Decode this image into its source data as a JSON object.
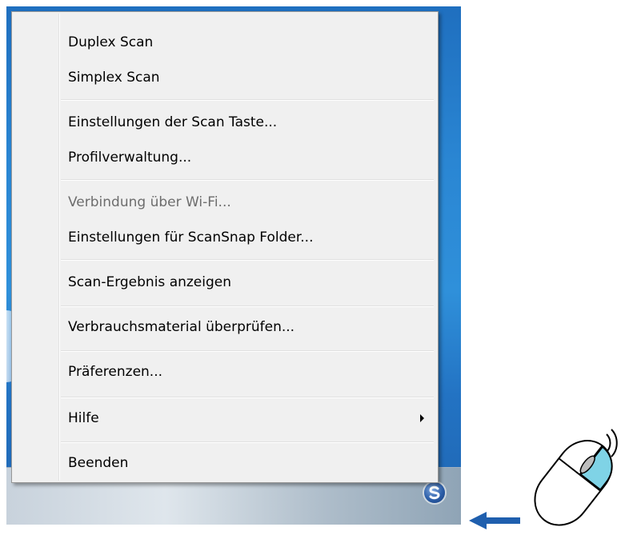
{
  "menu": {
    "items": [
      {
        "label": "Duplex Scan"
      },
      {
        "label": "Simplex Scan"
      },
      {
        "label": "Einstellungen der Scan Taste..."
      },
      {
        "label": "Profilverwaltung..."
      },
      {
        "label": "Verbindung über Wi-Fi..."
      },
      {
        "label": "Einstellungen für ScanSnap Folder..."
      },
      {
        "label": "Scan-Ergebnis anzeigen"
      },
      {
        "label": "Verbrauchsmaterial überprüfen..."
      },
      {
        "label": "Präferenzen..."
      },
      {
        "label": "Hilfe"
      },
      {
        "label": "Beenden"
      }
    ],
    "disabled_item": "Verbindung über Wi-Fi...",
    "submenu_item": "Hilfe"
  },
  "taskbar": {
    "tray_icon": "scansnap-manager-icon"
  },
  "annotation": {
    "pointer": "blue-left-arrow-icon",
    "mouse": "mouse-right-click-icon",
    "highlight_color": "#7fd3e6",
    "arrow_color": "#1f5fae"
  }
}
